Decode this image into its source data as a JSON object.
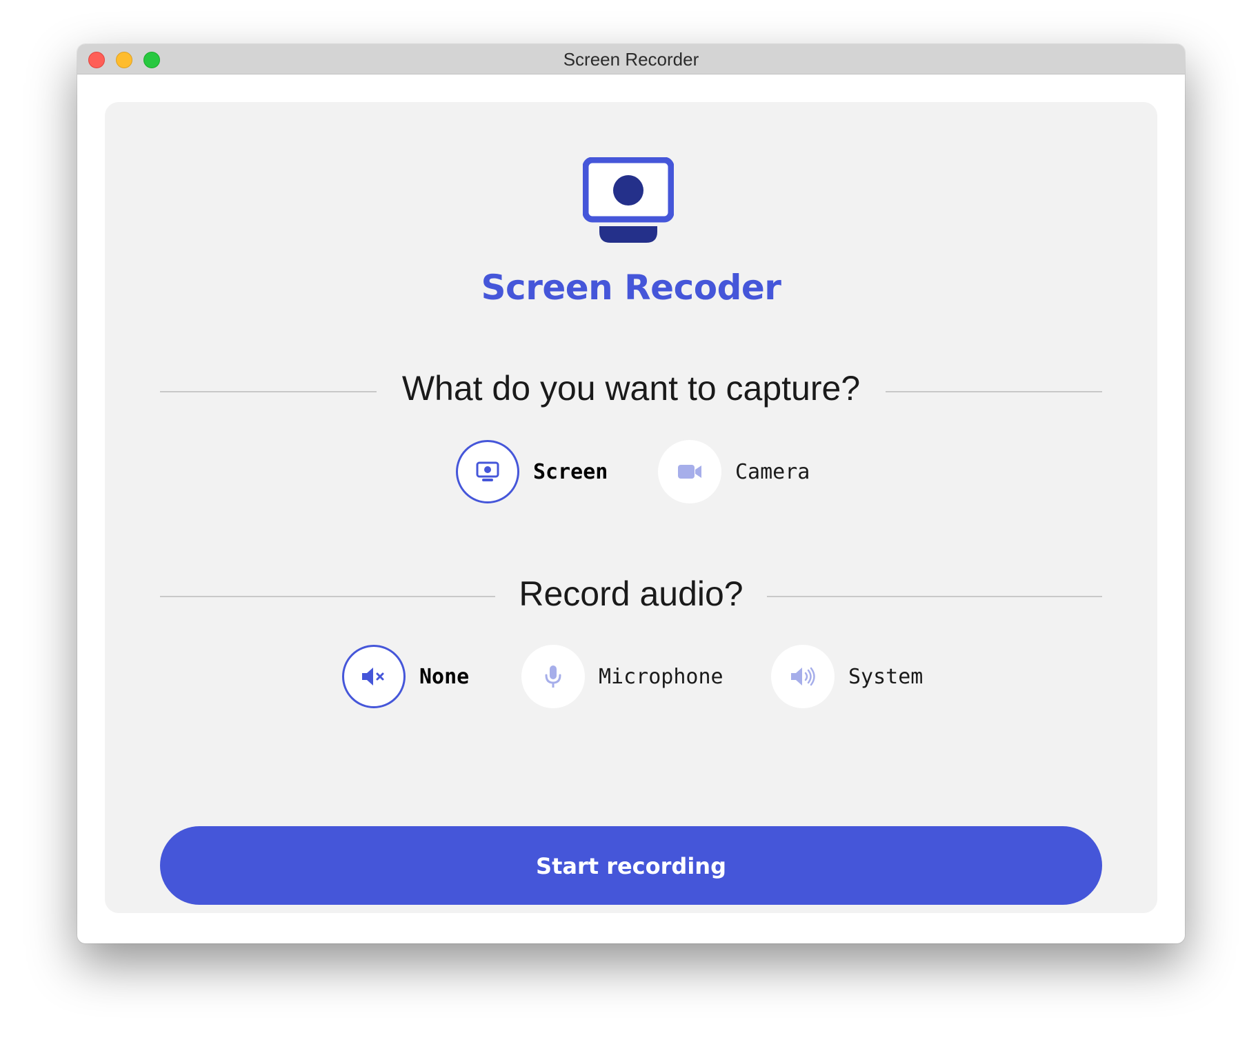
{
  "window": {
    "title": "Screen Recorder"
  },
  "app": {
    "title": "Screen Recoder",
    "logo_icon": "screen-record-icon",
    "accent_color": "#4556d9"
  },
  "capture": {
    "heading": "What do you want to capture?",
    "options": [
      {
        "label": "Screen",
        "icon": "monitor-icon",
        "selected": true
      },
      {
        "label": "Camera",
        "icon": "video-camera-icon",
        "selected": false
      }
    ]
  },
  "audio": {
    "heading": "Record audio?",
    "options": [
      {
        "label": "None",
        "icon": "speaker-muted-icon",
        "selected": true
      },
      {
        "label": "Microphone",
        "icon": "microphone-icon",
        "selected": false
      },
      {
        "label": "System",
        "icon": "speaker-volume-icon",
        "selected": false
      }
    ]
  },
  "actions": {
    "start_label": "Start recording"
  }
}
